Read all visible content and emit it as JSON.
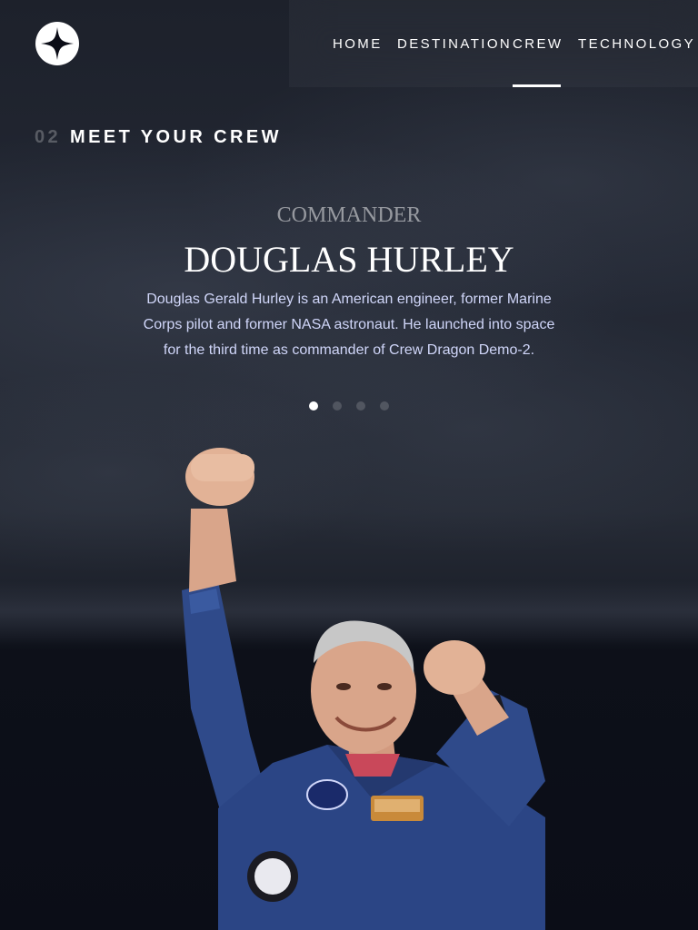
{
  "header": {
    "logo_icon": "star-logo-icon",
    "nav": [
      {
        "label": "HOME",
        "active": false
      },
      {
        "label": "DESTINATION",
        "active": false
      },
      {
        "label": "CREW",
        "active": true
      },
      {
        "label": "TECHNOLOGY",
        "active": false
      }
    ]
  },
  "section": {
    "number": "02",
    "title": "MEET YOUR CREW"
  },
  "crew": {
    "role": "COMMANDER",
    "name": "DOUGLAS HURLEY",
    "bio": "Douglas Gerald Hurley is an American engineer, former Marine Corps pilot and former NASA astronaut. He launched into space for the third time as commander of Crew Dragon Demo-2.",
    "slides_total": 4,
    "active_slide": 1
  },
  "colors": {
    "background": "#0b0d17",
    "text": "#ffffff",
    "muted": "#d0d6f9",
    "suit": "#2f4a8a"
  }
}
